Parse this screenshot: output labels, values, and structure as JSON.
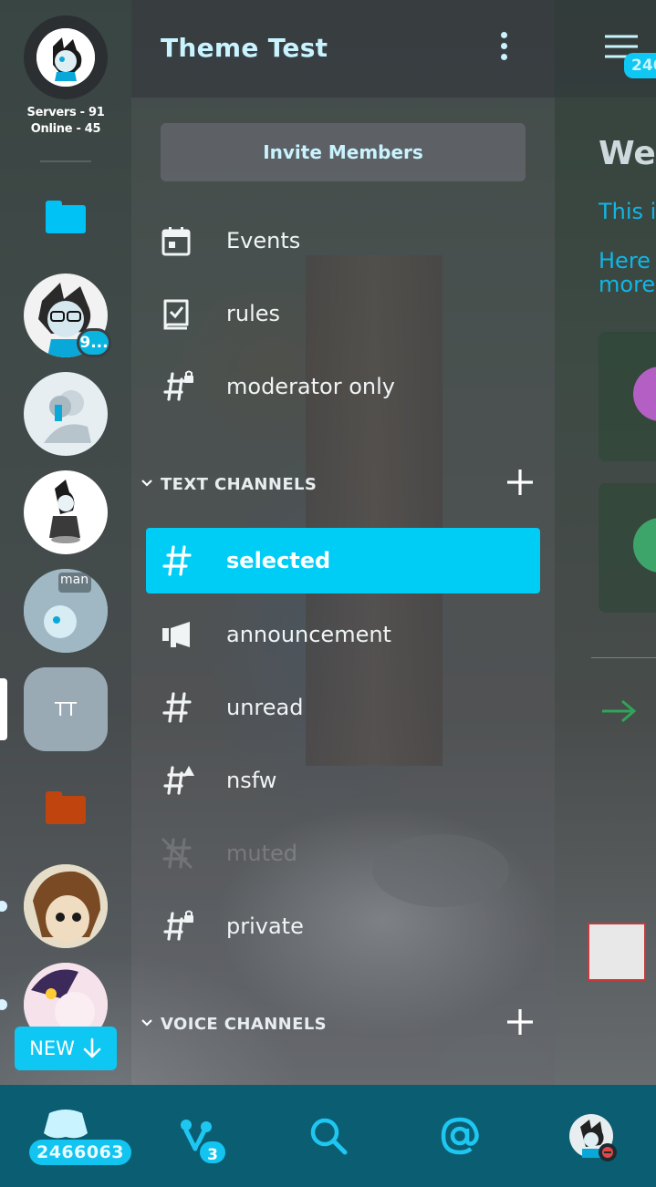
{
  "rail": {
    "stats_servers": "Servers - 91",
    "stats_online": "Online - 45",
    "mention_badge": "9...",
    "tt_server_label": "TT",
    "new_button_label": "NEW",
    "server_sticker_text": "man"
  },
  "panel": {
    "server_name": "Theme Test",
    "invite_label": "Invite Members",
    "top_items": [
      {
        "label": "Events",
        "icon": "calendar-icon"
      },
      {
        "label": "rules",
        "icon": "rules-book-icon"
      },
      {
        "label": "moderator only",
        "icon": "locked-hash-icon"
      }
    ],
    "text_category": "TEXT CHANNELS",
    "channels": [
      {
        "label": "selected",
        "icon": "hash-icon",
        "state": "selected"
      },
      {
        "label": "announcement",
        "icon": "megaphone-icon",
        "state": "normal"
      },
      {
        "label": "unread",
        "icon": "hash-icon",
        "state": "unread"
      },
      {
        "label": "nsfw",
        "icon": "nsfw-hash-icon",
        "state": "normal"
      },
      {
        "label": "muted",
        "icon": "muted-hash-icon",
        "state": "muted"
      },
      {
        "label": "private",
        "icon": "locked-hash-icon",
        "state": "normal"
      }
    ],
    "voice_category": "VOICE CHANNELS"
  },
  "peek": {
    "badge": "246",
    "heading": "We",
    "line1": "This i",
    "line2": "Here",
    "line3": "more"
  },
  "nav": {
    "home_count": "2466063",
    "friends_badge": "3"
  },
  "colors": {
    "accent": "#00cdf5",
    "nav_bg": "#0b5e72",
    "title": "#c9f4ff"
  }
}
